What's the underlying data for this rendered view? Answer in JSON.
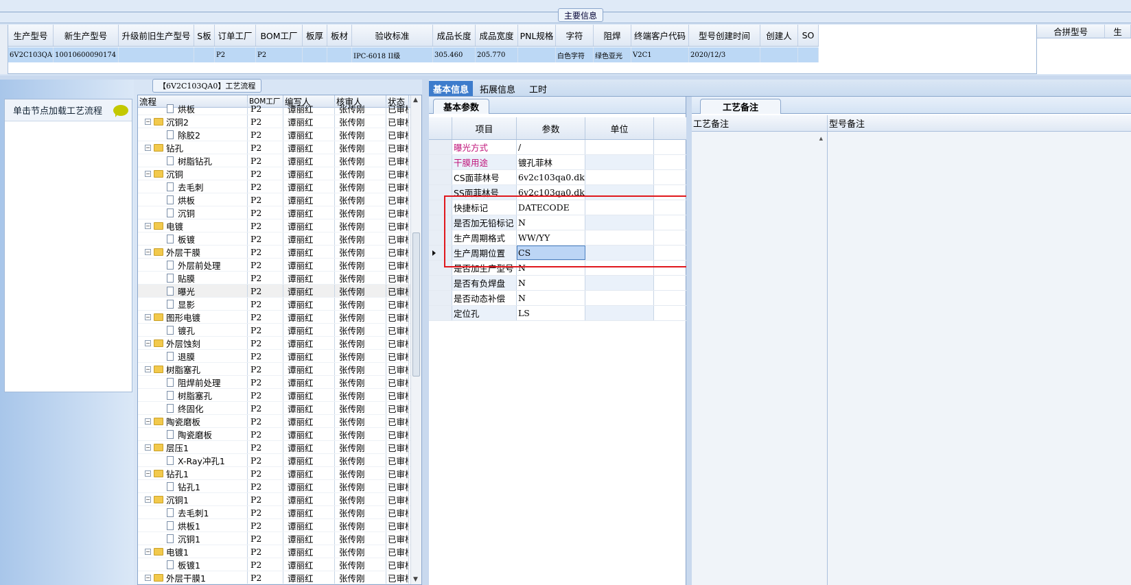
{
  "top": {
    "main_info_tag": "主要信息"
  },
  "main_grid": {
    "columns": [
      "生产型号",
      "新生产型号",
      "升级前旧生产型号",
      "S板",
      "订单工厂",
      "BOM工厂",
      "板厚",
      "板材",
      "验收标准",
      "成品长度",
      "成品宽度",
      "PNL规格",
      "字符",
      "阻焊",
      "终端客户代码",
      "型号创建时间",
      "创建人",
      "SO"
    ],
    "row": [
      "6V2C103QA0",
      "10010600090174",
      "",
      "",
      "P2",
      "P2",
      "",
      "",
      "IPC-6018 II级",
      "305.460",
      "205.770",
      "",
      "白色字符",
      "绿色亚光",
      "V2C1",
      "2020/12/3",
      "",
      ""
    ]
  },
  "merge_grid": {
    "columns": [
      "合拼型号",
      "生"
    ]
  },
  "left_panel": {
    "hint": "单击节点加载工艺流程"
  },
  "process_tab": "【6V2C103QA0】工艺流程",
  "tree": {
    "columns": [
      "流程",
      "BOM工厂",
      "编写人",
      "核审人",
      "状态"
    ],
    "rows": [
      {
        "level": 1,
        "type": "doc",
        "name": "烘板",
        "bom": "P2",
        "writer": "谭丽红",
        "reviewer": "张传刚",
        "status": "已审核"
      },
      {
        "level": 0,
        "type": "folder",
        "name": "沉铜2",
        "bom": "P2",
        "writer": "谭丽红",
        "reviewer": "张传刚",
        "status": "已审核"
      },
      {
        "level": 1,
        "type": "doc",
        "name": "除胶2",
        "bom": "P2",
        "writer": "谭丽红",
        "reviewer": "张传刚",
        "status": "已审核"
      },
      {
        "level": 0,
        "type": "folder",
        "name": "钻孔",
        "bom": "P2",
        "writer": "谭丽红",
        "reviewer": "张传刚",
        "status": "已审核"
      },
      {
        "level": 1,
        "type": "doc",
        "name": "树脂钻孔",
        "bom": "P2",
        "writer": "谭丽红",
        "reviewer": "张传刚",
        "status": "已审核"
      },
      {
        "level": 0,
        "type": "folder",
        "name": "沉铜",
        "bom": "P2",
        "writer": "谭丽红",
        "reviewer": "张传刚",
        "status": "已审核"
      },
      {
        "level": 1,
        "type": "doc",
        "name": "去毛刺",
        "bom": "P2",
        "writer": "谭丽红",
        "reviewer": "张传刚",
        "status": "已审核"
      },
      {
        "level": 1,
        "type": "doc",
        "name": "烘板",
        "bom": "P2",
        "writer": "谭丽红",
        "reviewer": "张传刚",
        "status": "已审核"
      },
      {
        "level": 1,
        "type": "doc",
        "name": "沉铜",
        "bom": "P2",
        "writer": "谭丽红",
        "reviewer": "张传刚",
        "status": "已审核"
      },
      {
        "level": 0,
        "type": "folder",
        "name": "电镀",
        "bom": "P2",
        "writer": "谭丽红",
        "reviewer": "张传刚",
        "status": "已审核"
      },
      {
        "level": 1,
        "type": "doc",
        "name": "板镀",
        "bom": "P2",
        "writer": "谭丽红",
        "reviewer": "张传刚",
        "status": "已审核"
      },
      {
        "level": 0,
        "type": "folder",
        "name": "外层干膜",
        "bom": "P2",
        "writer": "谭丽红",
        "reviewer": "张传刚",
        "status": "已审核"
      },
      {
        "level": 1,
        "type": "doc",
        "name": "外层前处理",
        "bom": "P2",
        "writer": "谭丽红",
        "reviewer": "张传刚",
        "status": "已审核"
      },
      {
        "level": 1,
        "type": "doc",
        "name": "贴膜",
        "bom": "P2",
        "writer": "谭丽红",
        "reviewer": "张传刚",
        "status": "已审核"
      },
      {
        "level": 1,
        "type": "doc",
        "name": "曝光",
        "bom": "P2",
        "writer": "谭丽红",
        "reviewer": "张传刚",
        "status": "已审核",
        "selected": true
      },
      {
        "level": 1,
        "type": "doc",
        "name": "显影",
        "bom": "P2",
        "writer": "谭丽红",
        "reviewer": "张传刚",
        "status": "已审核"
      },
      {
        "level": 0,
        "type": "folder",
        "name": "图形电镀",
        "bom": "P2",
        "writer": "谭丽红",
        "reviewer": "张传刚",
        "status": "已审核"
      },
      {
        "level": 1,
        "type": "doc",
        "name": "镀孔",
        "bom": "P2",
        "writer": "谭丽红",
        "reviewer": "张传刚",
        "status": "已审核"
      },
      {
        "level": 0,
        "type": "folder",
        "name": "外层蚀刻",
        "bom": "P2",
        "writer": "谭丽红",
        "reviewer": "张传刚",
        "status": "已审核"
      },
      {
        "level": 1,
        "type": "doc",
        "name": "退膜",
        "bom": "P2",
        "writer": "谭丽红",
        "reviewer": "张传刚",
        "status": "已审核"
      },
      {
        "level": 0,
        "type": "folder",
        "name": "树脂塞孔",
        "bom": "P2",
        "writer": "谭丽红",
        "reviewer": "张传刚",
        "status": "已审核"
      },
      {
        "level": 1,
        "type": "doc",
        "name": "阻焊前处理",
        "bom": "P2",
        "writer": "谭丽红",
        "reviewer": "张传刚",
        "status": "已审核"
      },
      {
        "level": 1,
        "type": "doc",
        "name": "树脂塞孔",
        "bom": "P2",
        "writer": "谭丽红",
        "reviewer": "张传刚",
        "status": "已审核"
      },
      {
        "level": 1,
        "type": "doc",
        "name": "终固化",
        "bom": "P2",
        "writer": "谭丽红",
        "reviewer": "张传刚",
        "status": "已审核"
      },
      {
        "level": 0,
        "type": "folder",
        "name": "陶瓷磨板",
        "bom": "P2",
        "writer": "谭丽红",
        "reviewer": "张传刚",
        "status": "已审核"
      },
      {
        "level": 1,
        "type": "doc",
        "name": "陶瓷磨板",
        "bom": "P2",
        "writer": "谭丽红",
        "reviewer": "张传刚",
        "status": "已审核"
      },
      {
        "level": 0,
        "type": "folder",
        "name": "层压1",
        "bom": "P2",
        "writer": "谭丽红",
        "reviewer": "张传刚",
        "status": "已审核"
      },
      {
        "level": 1,
        "type": "doc",
        "name": "X-Ray冲孔1",
        "bom": "P2",
        "writer": "谭丽红",
        "reviewer": "张传刚",
        "status": "已审核"
      },
      {
        "level": 0,
        "type": "folder",
        "name": "钻孔1",
        "bom": "P2",
        "writer": "谭丽红",
        "reviewer": "张传刚",
        "status": "已审核"
      },
      {
        "level": 1,
        "type": "doc",
        "name": "钻孔1",
        "bom": "P2",
        "writer": "谭丽红",
        "reviewer": "张传刚",
        "status": "已审核"
      },
      {
        "level": 0,
        "type": "folder",
        "name": "沉铜1",
        "bom": "P2",
        "writer": "谭丽红",
        "reviewer": "张传刚",
        "status": "已审核"
      },
      {
        "level": 1,
        "type": "doc",
        "name": "去毛刺1",
        "bom": "P2",
        "writer": "谭丽红",
        "reviewer": "张传刚",
        "status": "已审核"
      },
      {
        "level": 1,
        "type": "doc",
        "name": "烘板1",
        "bom": "P2",
        "writer": "谭丽红",
        "reviewer": "张传刚",
        "status": "已审核"
      },
      {
        "level": 1,
        "type": "doc",
        "name": "沉铜1",
        "bom": "P2",
        "writer": "谭丽红",
        "reviewer": "张传刚",
        "status": "已审核"
      },
      {
        "level": 0,
        "type": "folder",
        "name": "电镀1",
        "bom": "P2",
        "writer": "谭丽红",
        "reviewer": "张传刚",
        "status": "已审核"
      },
      {
        "level": 1,
        "type": "doc",
        "name": "板镀1",
        "bom": "P2",
        "writer": "谭丽红",
        "reviewer": "张传刚",
        "status": "已审核"
      },
      {
        "level": 0,
        "type": "folder",
        "name": "外层干膜1",
        "bom": "P2",
        "writer": "谭丽红",
        "reviewer": "张传刚",
        "status": "已审核"
      }
    ]
  },
  "mid_tabs": [
    "基本信息",
    "拓展信息",
    "工时"
  ],
  "basic_params": {
    "tab": "基本参数",
    "columns": [
      "项目",
      "参数",
      "单位"
    ],
    "rows": [
      {
        "item": "曝光方式",
        "param": "/",
        "unit": "",
        "pink": true
      },
      {
        "item": "干膜用途",
        "param": "镀孔菲林",
        "unit": "",
        "pink": true
      },
      {
        "item": "CS面菲林号",
        "param": "6v2c103qa0.dkst",
        "unit": ""
      },
      {
        "item": "SS面菲林号",
        "param": "6v2c103qa0.dksb",
        "unit": ""
      },
      {
        "item": "快捷标记",
        "param": "DATECODE",
        "unit": ""
      },
      {
        "item": "是否加无铅标记",
        "param": "N",
        "unit": ""
      },
      {
        "item": "生产周期格式",
        "param": "WW/YY",
        "unit": ""
      },
      {
        "item": "生产周期位置",
        "param": "CS",
        "unit": "",
        "current": true
      },
      {
        "item": "是否加生产型号",
        "param": "N",
        "unit": ""
      },
      {
        "item": "是否有负焊盘",
        "param": "N",
        "unit": ""
      },
      {
        "item": "是否动态补偿",
        "param": "N",
        "unit": ""
      },
      {
        "item": "定位孔",
        "param": "LS",
        "unit": ""
      }
    ]
  },
  "remarks": {
    "tab": "工艺备注",
    "columns": [
      "工艺备注",
      "型号备注"
    ]
  },
  "colors": {
    "highlight": "#e0161b",
    "active_tab": "#3d7ccc",
    "pink_text": "#c0147a",
    "selected_row": "#bcd8f5"
  }
}
